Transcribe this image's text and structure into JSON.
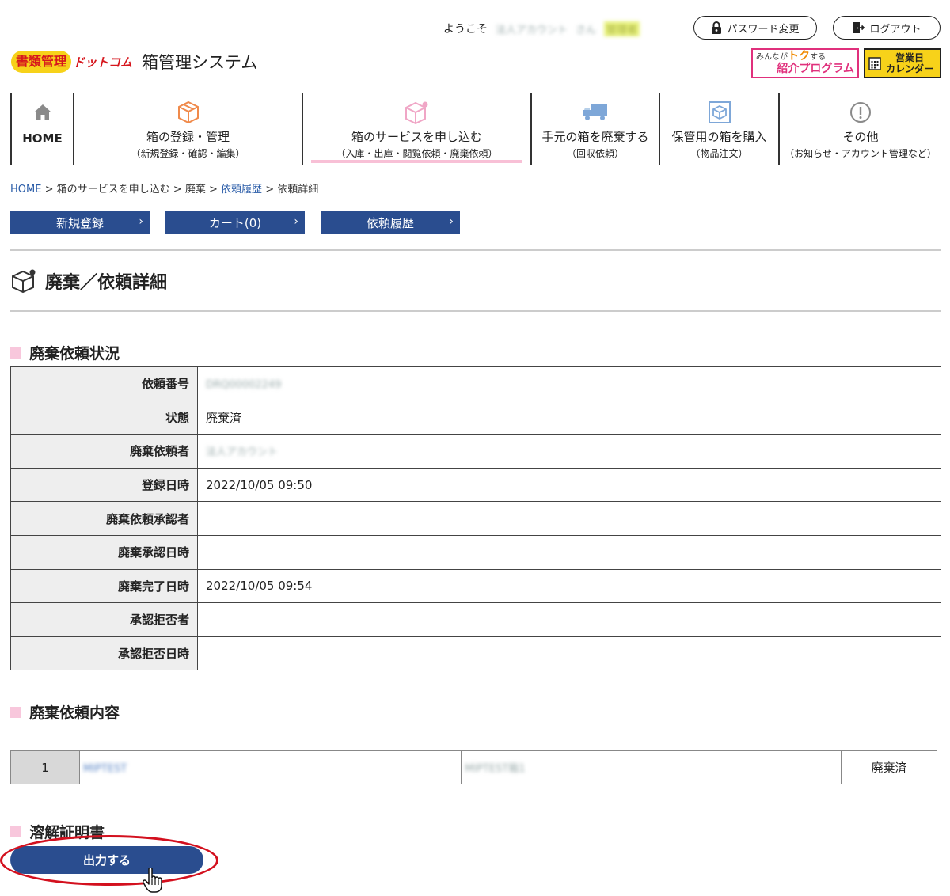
{
  "header": {
    "welcome": "ようこそ",
    "user_name": "法人アカウント",
    "san": "さん",
    "role": "管理者",
    "password_btn": "パスワード変更",
    "logout_btn": "ログアウト",
    "logo_mark": "書類管理",
    "logo_dotcom": "ドットコム",
    "system_name": "箱管理システム",
    "promo_line1a": "みんなが",
    "promo_line1b": "トク",
    "promo_line1c": "する",
    "promo_line2": "紹介プログラム",
    "calendar_line1": "営業日",
    "calendar_line2": "カレンダー"
  },
  "nav": {
    "home": "HOME",
    "items": [
      {
        "label": "箱の登録・管理",
        "sub": "（新規登録・確認・編集）"
      },
      {
        "label": "箱のサービスを申し込む",
        "sub": "（入庫・出庫・閲覧依頼・廃棄依頼）"
      },
      {
        "label": "手元の箱を廃棄する",
        "sub": "（回収依頼）"
      },
      {
        "label": "保管用の箱を購入",
        "sub": "（物品注文）"
      },
      {
        "label": "その他",
        "sub": "（お知らせ・アカウント管理など）"
      }
    ]
  },
  "breadcrumb": {
    "home": "HOME",
    "sep": ">",
    "b1": "箱のサービスを申し込む",
    "b2": "廃棄",
    "b3": "依頼履歴",
    "b4": "依頼詳細"
  },
  "sub_buttons": {
    "new": "新規登録",
    "cart": "カート(0)",
    "history": "依頼履歴",
    "chevron": "›"
  },
  "page_title": "廃棄／依頼詳細",
  "status_section": {
    "heading": "廃棄依頼状況",
    "rows": [
      {
        "key": "依頼番号",
        "value": "DRQ00002249"
      },
      {
        "key": "状態",
        "value": "廃棄済"
      },
      {
        "key": "廃棄依頼者",
        "value": "法人アカウント"
      },
      {
        "key": "登録日時",
        "value": "2022/10/05 09:50"
      },
      {
        "key": "廃棄依頼承認者",
        "value": ""
      },
      {
        "key": "廃棄承認日時",
        "value": ""
      },
      {
        "key": "廃棄完了日時",
        "value": "2022/10/05 09:54"
      },
      {
        "key": "承認拒否者",
        "value": ""
      },
      {
        "key": "承認拒否日時",
        "value": ""
      }
    ]
  },
  "content_section": {
    "heading": "廃棄依頼内容",
    "rows": [
      {
        "index": "1",
        "box_id": "MIPTEST",
        "box_name": "MIPTEST箱1",
        "status": "廃棄済"
      }
    ]
  },
  "certificate_section": {
    "heading": "溶解証明書",
    "output_btn": "出力する"
  },
  "colors": {
    "primary": "#2a4d8f",
    "accent_pink": "#f8c7dc",
    "highlight_red": "#d3101e",
    "logo_yellow": "#f7d21a"
  }
}
